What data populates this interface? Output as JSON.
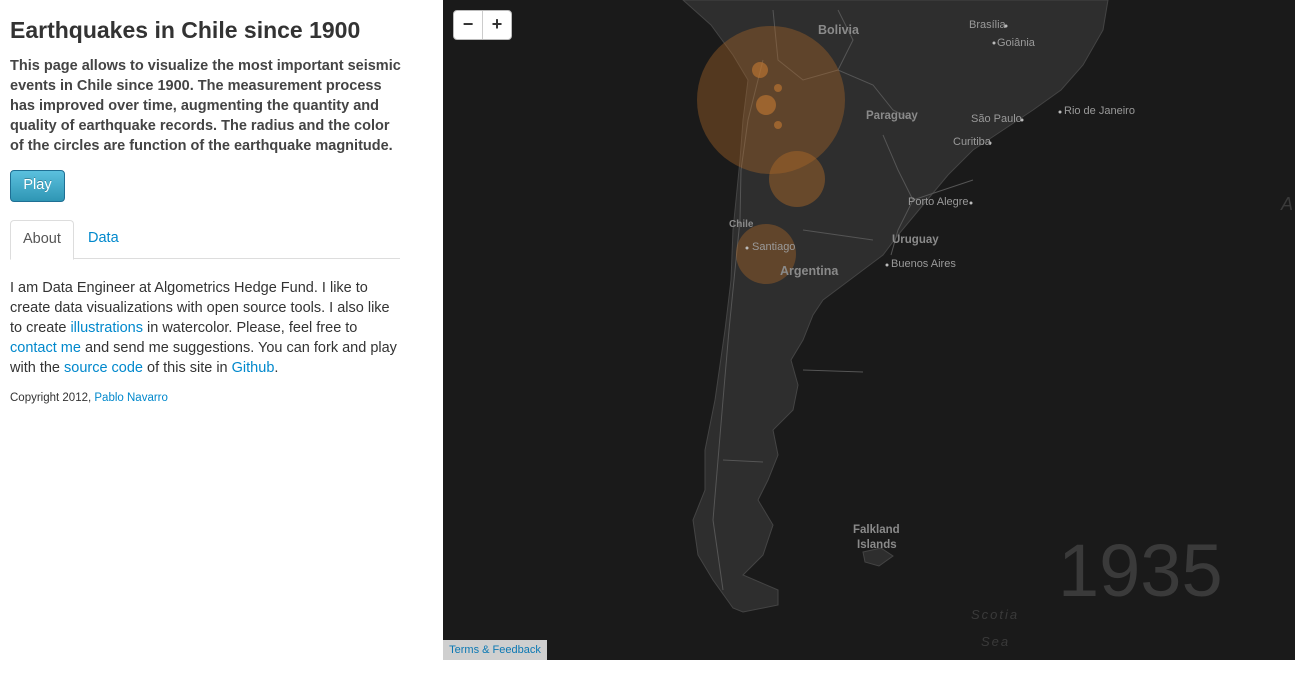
{
  "header": {
    "title": "Earthquakes in Chile since 1900",
    "description": "This page allows to visualize the most important seismic events in Chile since 1900. The measurement process has improved over time, augmenting the quantity and quality of earthquake records. The radius and the color of the circles are function of the earthquake magnitude."
  },
  "controls": {
    "play_label": "Play"
  },
  "tabs": [
    {
      "label": "About",
      "active": true
    },
    {
      "label": "Data",
      "active": false
    }
  ],
  "about": {
    "t1": "I am Data Engineer at Algometrics Hedge Fund. I like to create data visualizations with open source tools. I also like to create ",
    "link_illustrations": "illustrations",
    "t2": " in watercolor. Please, feel free to ",
    "link_contact": "contact me",
    "t3": " and send me suggestions. You can fork and play with the ",
    "link_source": "source code",
    "t4": " of this site in ",
    "link_github": "Github",
    "t5": "."
  },
  "footer": {
    "copyright": "Copyright 2012, ",
    "author": "Pablo Navarro"
  },
  "map": {
    "zoom_out": "−",
    "zoom_in": "+",
    "year": "1935",
    "terms": "Terms & Feedback",
    "labels": {
      "bolivia": "Bolivia",
      "brasilia": "Brasília",
      "goiania": "Goiânia",
      "paraguay": "Paraguay",
      "sao_paulo": "São Paulo",
      "rio": "Rio de Janeiro",
      "curitiba": "Curitiba",
      "porto_alegre": "Porto Alegre",
      "uruguay": "Uruguay",
      "buenos_aires": "Buenos Aires",
      "chile": "Chile",
      "santiago": "Santiago",
      "argentina": "Argentina",
      "falkland_1": "Falkland",
      "falkland_2": "Islands",
      "scotia": "Scotia",
      "sea": "Sea",
      "edge": "A"
    },
    "colors": {
      "background": "#1a1a1a",
      "land": "#2f2f2f",
      "quake": "#b06a28"
    }
  }
}
